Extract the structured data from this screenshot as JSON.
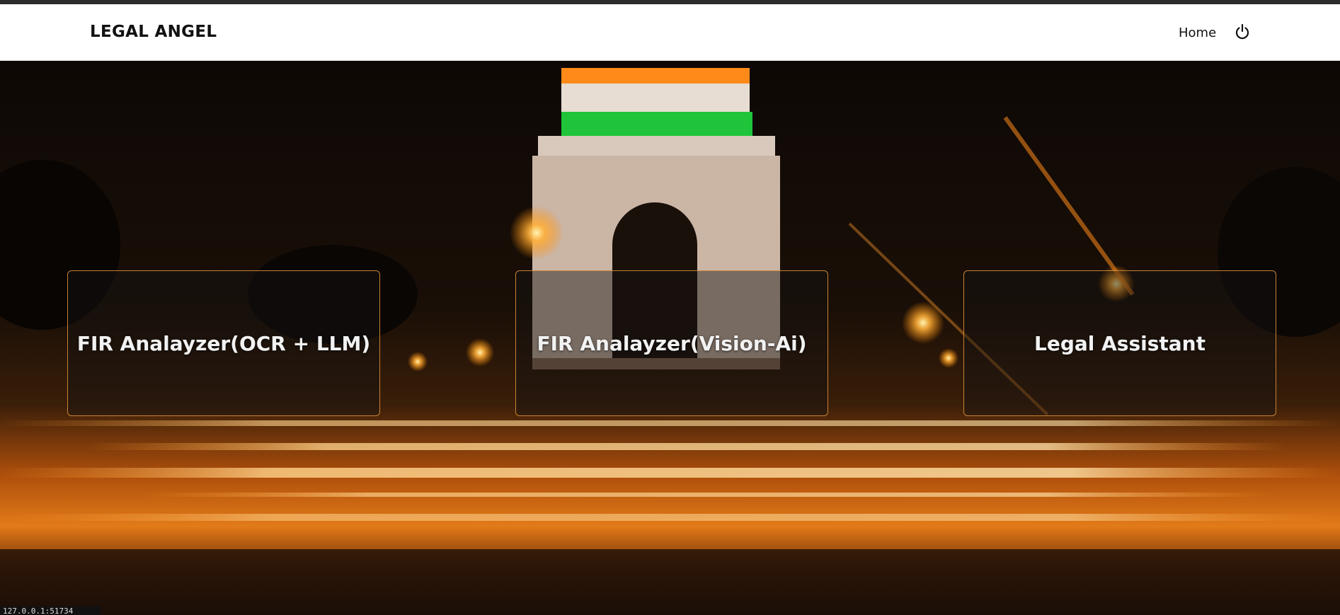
{
  "header": {
    "brand": "LEGAL ANGEL",
    "nav": {
      "home_label": "Home",
      "power_icon": "power-icon"
    }
  },
  "hero": {
    "background": "India Gate at night with orange light trails",
    "cards": [
      {
        "label": "FIR Analayzer(OCR + LLM)"
      },
      {
        "label": "FIR Analayzer(Vision-Ai)"
      },
      {
        "label": "Legal Assistant"
      }
    ]
  },
  "status": {
    "url": "127.0.0.1:51734"
  },
  "colors": {
    "accent": "#e8963c",
    "navbar_bg": "#ffffff",
    "card_border": "#e69a3c"
  }
}
